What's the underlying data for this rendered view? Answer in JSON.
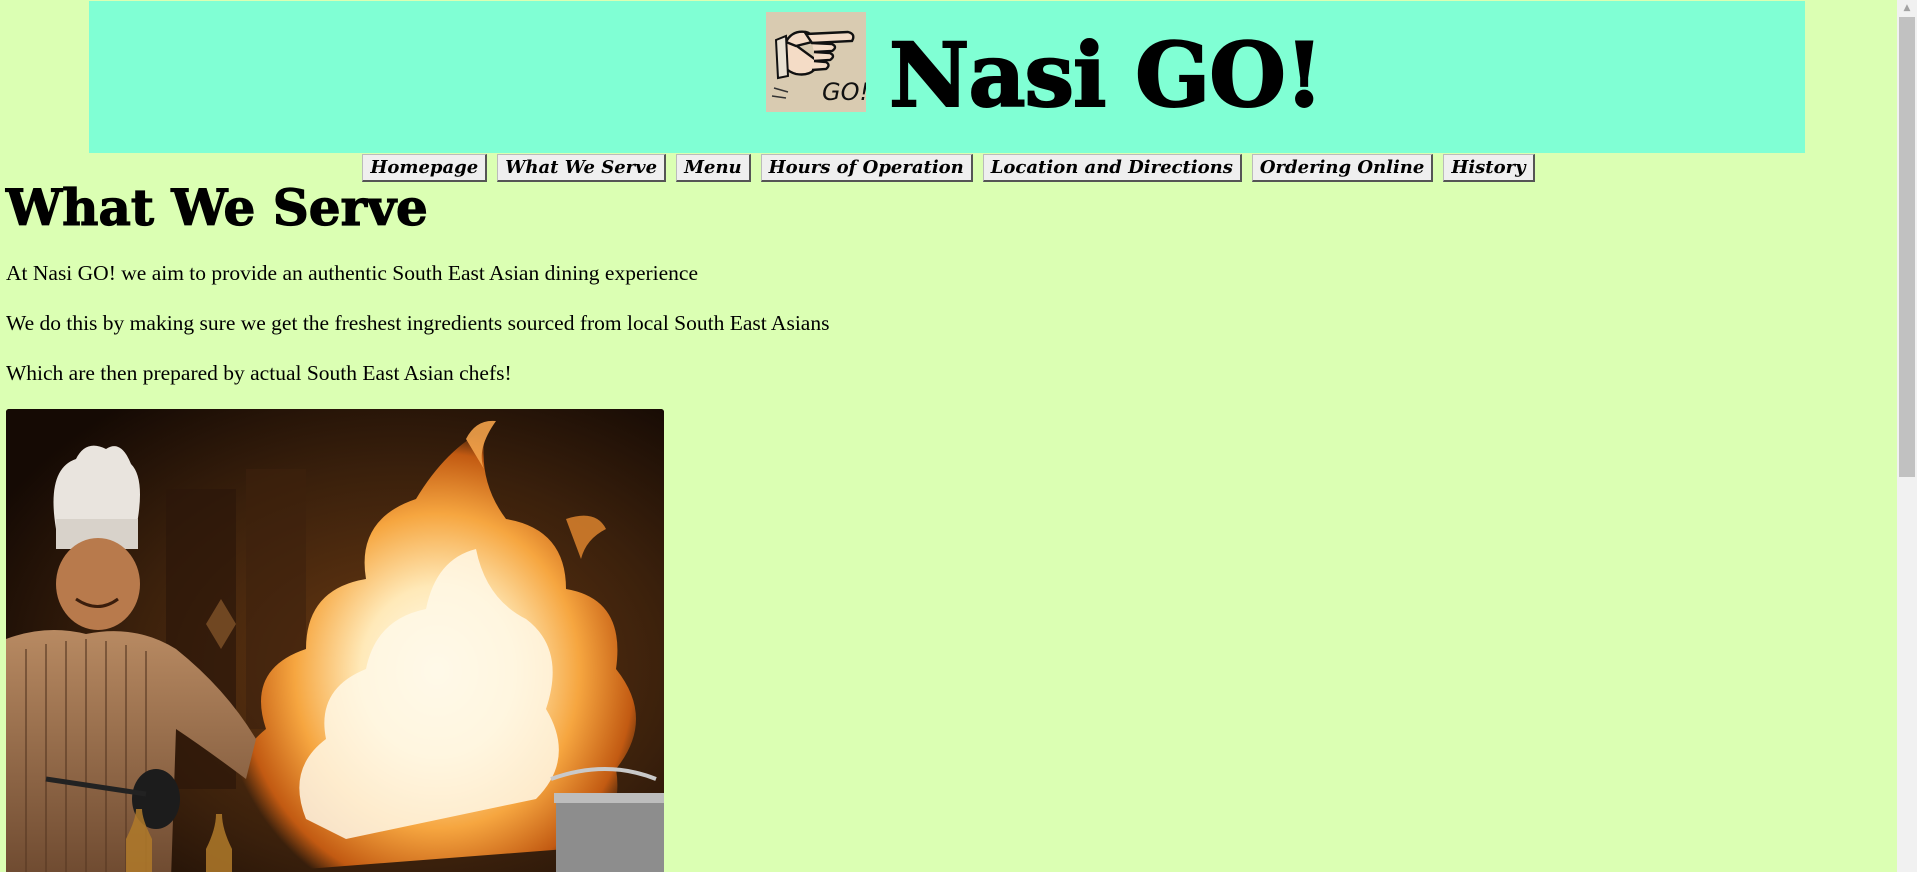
{
  "site": {
    "title": "Nasi GO!",
    "logo_text": "GO!"
  },
  "nav": {
    "items": [
      {
        "label": "Homepage"
      },
      {
        "label": "What We Serve"
      },
      {
        "label": "Menu"
      },
      {
        "label": "Hours of Operation"
      },
      {
        "label": "Location and Directions"
      },
      {
        "label": "Ordering Online"
      },
      {
        "label": "History"
      }
    ]
  },
  "main": {
    "heading": "What We Serve",
    "paragraphs": [
      "At Nasi GO! we aim to provide an authentic South East Asian dining experience",
      "We do this by making sure we get the freshest ingredients sourced from local South East Asians",
      "Which are then prepared by actual South East Asian chefs!"
    ]
  },
  "scrollbar": {
    "up_arrow": "▲"
  },
  "colors": {
    "page_background": "#dbffb3",
    "banner_background": "#80ffd4",
    "button_background": "#efefef"
  },
  "icons": {
    "logo": "pointing-hand-icon",
    "scroll_up": "up-arrow-icon"
  }
}
